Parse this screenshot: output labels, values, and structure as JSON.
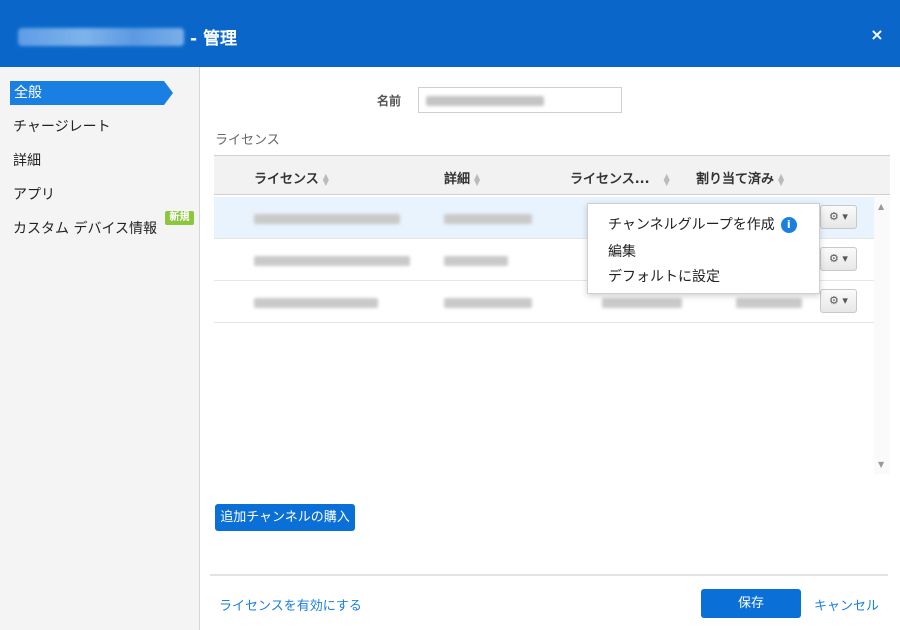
{
  "header": {
    "title_suffix": "- 管理",
    "close_label": "×"
  },
  "sidebar": {
    "items": [
      {
        "label": "全般"
      },
      {
        "label": "チャージレート"
      },
      {
        "label": "詳細"
      },
      {
        "label": "アプリ"
      },
      {
        "label": "カスタム デバイス情報"
      }
    ],
    "new_badge": "新規"
  },
  "form": {
    "name_label": "名前"
  },
  "license_section": {
    "label": "ライセンス"
  },
  "grid": {
    "columns": [
      "ライセンス",
      "詳細",
      "ライセンス...",
      "割り当て済み"
    ],
    "row_count": 3
  },
  "context_menu": {
    "items": [
      "チャンネルグループを作成",
      "編集",
      "デフォルトに設定"
    ],
    "info_icon": "i"
  },
  "buttons": {
    "buy": "追加チャンネルの購入",
    "activate": "ライセンスを有効にする",
    "save": "保存",
    "cancel": "キャンセル"
  },
  "icons": {
    "gear": "gear-icon",
    "chevron": "chevron-down-icon",
    "info": "info-icon",
    "close": "close-icon"
  },
  "colors": {
    "header": "#0a67c9",
    "accent": "#1a7fe3",
    "badge": "#8cc63f",
    "selected_row": "#e8f3fd"
  }
}
